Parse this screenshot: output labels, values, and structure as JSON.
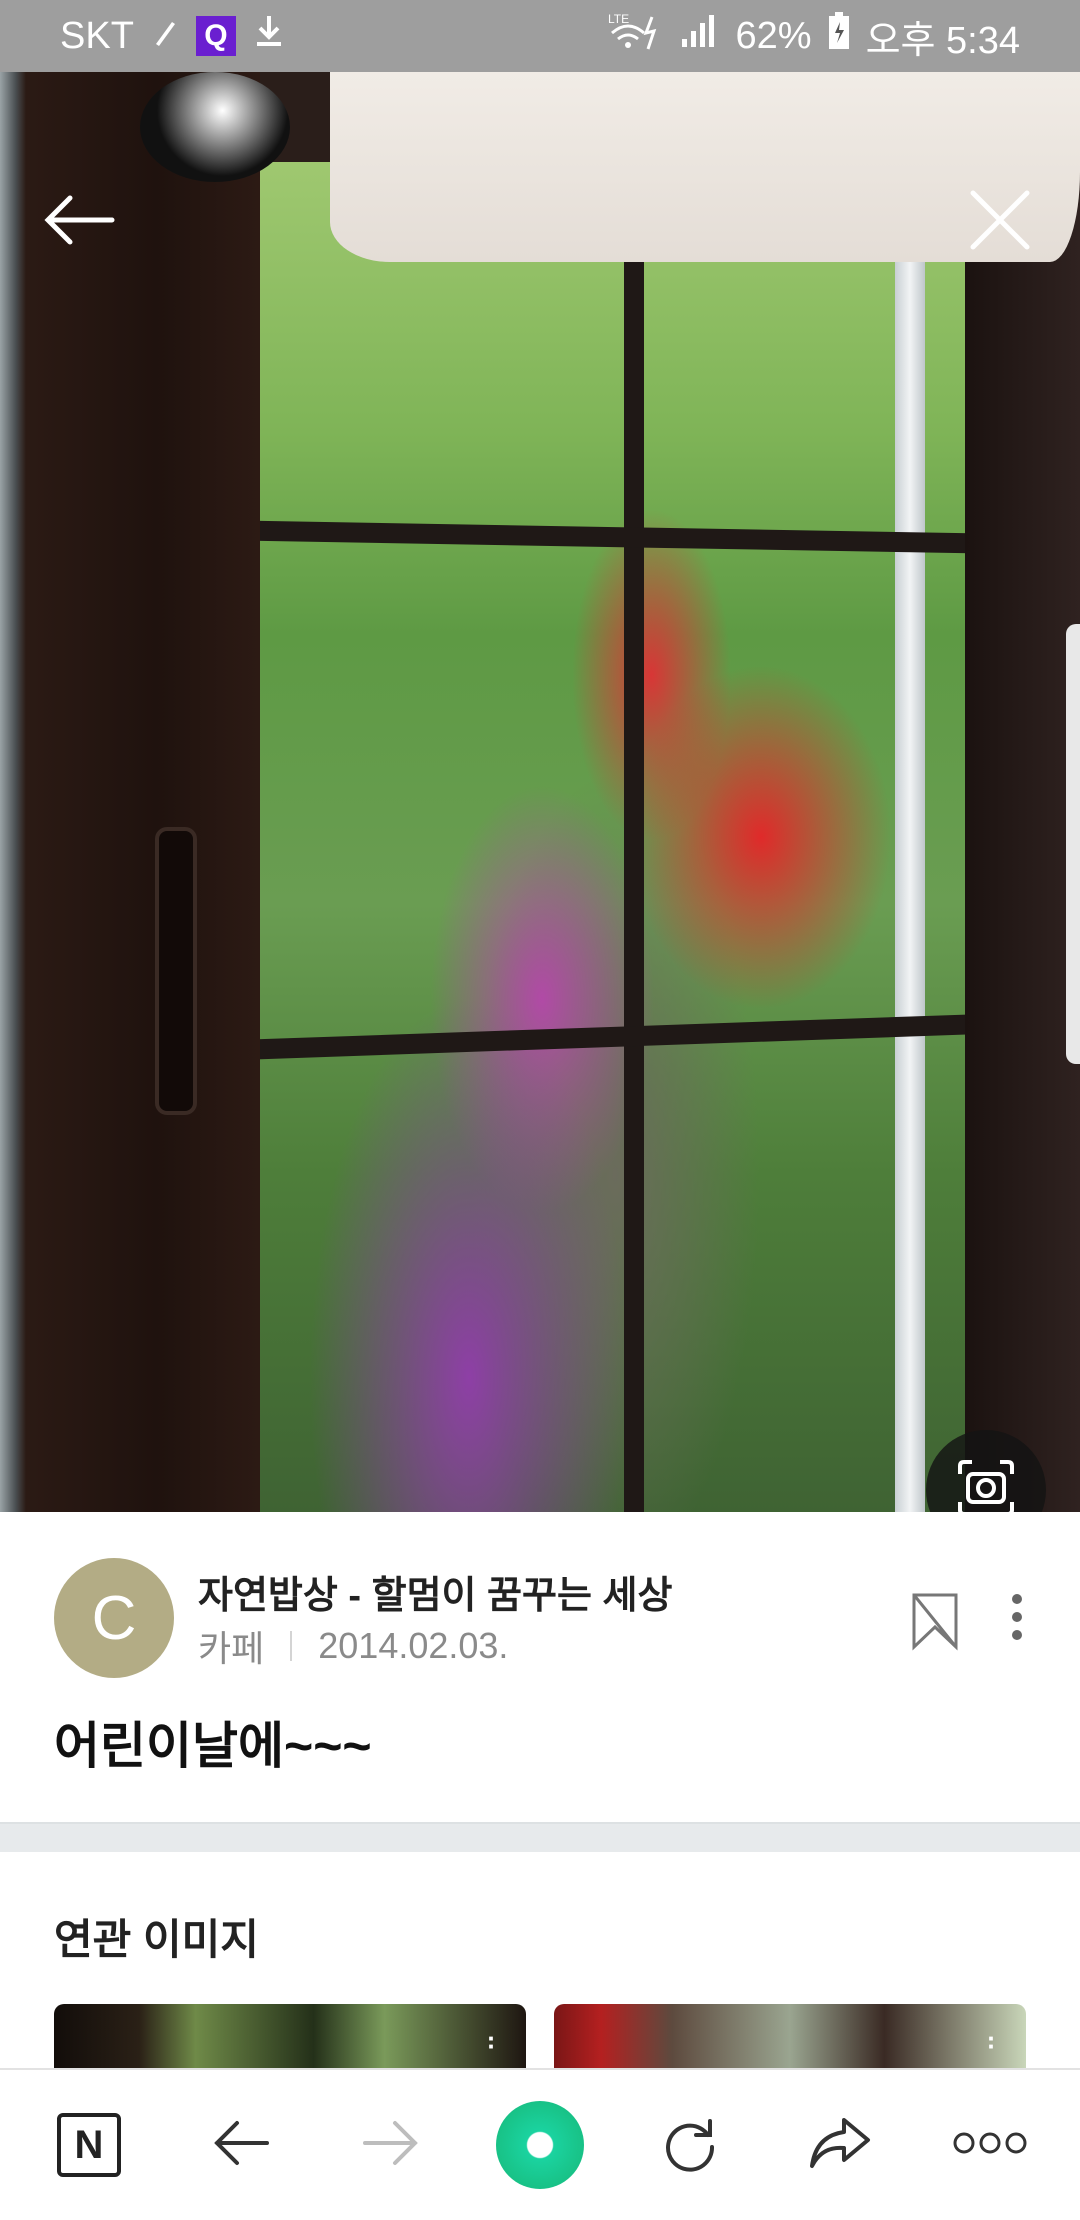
{
  "status_bar": {
    "carrier": "SKT",
    "q_badge": "Q",
    "network": "LTE",
    "battery": "62%",
    "time": "오후 5:34"
  },
  "viewer": {
    "back_icon": "arrow-left-icon",
    "close_icon": "close-icon",
    "lens_icon": "image-search-icon"
  },
  "post": {
    "avatar_letter": "C",
    "avatar_color": "#b3ac85",
    "source_name": "자연밥상 - 할멈이 꿈꾸는 세상",
    "source_type": "카페",
    "date": "2014.02.03.",
    "title": "어린이날에~~~"
  },
  "related": {
    "title": "연관 이미지"
  },
  "bottom_nav": {
    "n_label": "N",
    "items": [
      "naver-home-icon",
      "back-arrow-icon",
      "forward-arrow-icon",
      "green-dot-icon",
      "refresh-icon",
      "share-icon",
      "more-dots-icon"
    ]
  }
}
